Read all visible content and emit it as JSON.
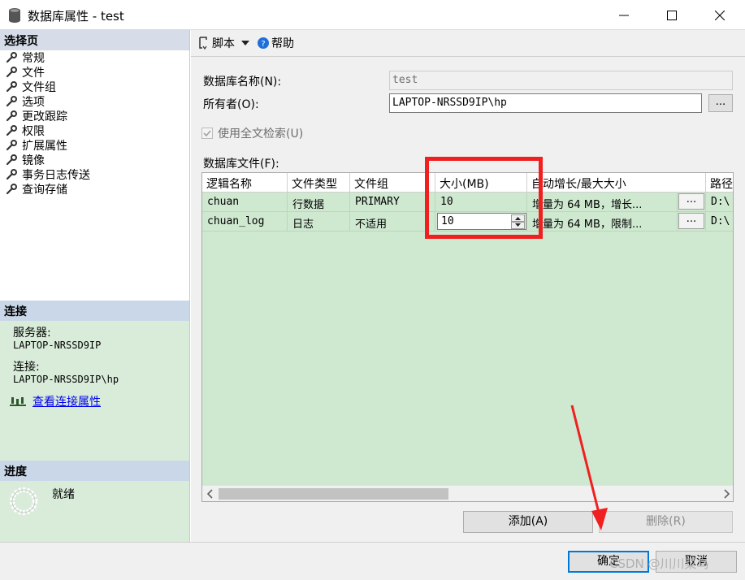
{
  "window": {
    "title": "数据库属性 - test"
  },
  "left_panel": {
    "select_page_header": "选择页",
    "items": [
      {
        "label": "常规"
      },
      {
        "label": "文件"
      },
      {
        "label": "文件组"
      },
      {
        "label": "选项"
      },
      {
        "label": "更改跟踪"
      },
      {
        "label": "权限"
      },
      {
        "label": "扩展属性"
      },
      {
        "label": "镜像"
      },
      {
        "label": "事务日志传送"
      },
      {
        "label": "查询存储"
      }
    ],
    "connection_header": "连接",
    "server_label": "服务器:",
    "server_value": "LAPTOP-NRSSD9IP",
    "connection_label": "连接:",
    "connection_value": "LAPTOP-NRSSD9IP\\hp",
    "view_connection_link": "查看连接属性",
    "progress_header": "进度",
    "progress_status": "就绪"
  },
  "toolbar": {
    "script_label": "脚本",
    "help_label": "帮助"
  },
  "form": {
    "db_name_label": "数据库名称(N):",
    "db_name_value": "test",
    "owner_label": "所有者(O):",
    "owner_value": "LAPTOP-NRSSD9IP\\hp",
    "browse_label": "...",
    "fulltext_label": "使用全文检索(U)",
    "db_files_label": "数据库文件(F):"
  },
  "grid": {
    "columns": [
      "逻辑名称",
      "文件类型",
      "文件组",
      "大小(MB)",
      "自动增长/最大大小",
      "路径"
    ],
    "rows": [
      {
        "name": "chuan",
        "type": "行数据",
        "filegroup": "PRIMARY",
        "size": "10",
        "autogrowth": "增量为 64 MB，增长...",
        "btn": "...",
        "path": "D:\\"
      },
      {
        "name": "chuan_log",
        "type": "日志",
        "filegroup": "不适用",
        "size": "10",
        "autogrowth": "增量为 64 MB，限制...",
        "btn": "...",
        "path": "D:\\"
      }
    ]
  },
  "buttons": {
    "add": "添加(A)",
    "remove": "删除(R)",
    "ok": "确定",
    "cancel": "取消"
  },
  "watermark": "CSDN @川川菜鸟",
  "colors": {
    "accent": "#0078d7",
    "annotation": "#f02020",
    "grid_bg": "#cfe8d0"
  }
}
